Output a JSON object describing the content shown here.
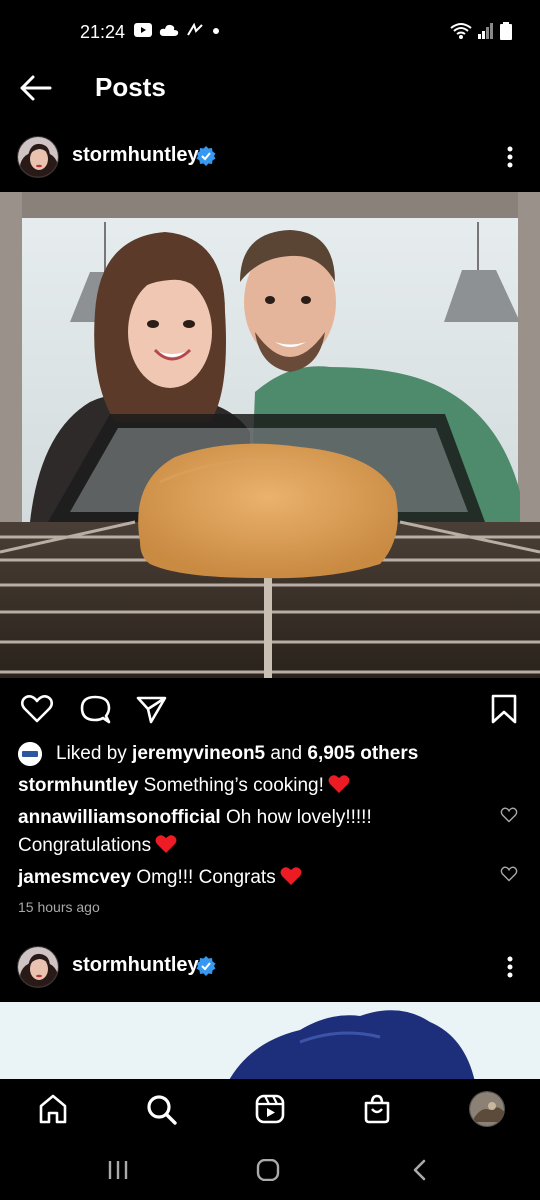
{
  "status_bar": {
    "time": "21:24",
    "left_icons": [
      "youtube-icon",
      "cloud-icon",
      "wave-icon",
      "dot-icon"
    ],
    "right_icons": [
      "wifi-icon",
      "signal-icon",
      "battery-icon"
    ]
  },
  "header": {
    "title": "Posts",
    "back_icon": "back-arrow-icon"
  },
  "post": {
    "username": "stormhuntley",
    "verified": true,
    "image_description_icon": "photo",
    "likes": {
      "prefix": "Liked by ",
      "liked_by": "jeremyvineon5",
      "middle": " and ",
      "others": "6,905 others"
    },
    "caption": {
      "username": "stormhuntley",
      "text": " Something’s cooking!"
    },
    "comments": [
      {
        "username": "annawilliamsonofficial",
        "text": " Oh how lovely!!!!! Congratulations"
      },
      {
        "username": "jamesmcvey",
        "text": " Omg!!! Congrats"
      }
    ],
    "time_ago": "15 hours ago"
  },
  "post2": {
    "username": "stormhuntley",
    "verified": true
  },
  "bottom_nav": {
    "items": [
      "home-icon",
      "search-icon",
      "reels-icon",
      "shop-icon",
      "profile-avatar"
    ]
  },
  "colors": {
    "background": "#000000",
    "verified_blue": "#3897f0",
    "heart_red": "#ed1c24",
    "muted_text": "#a8a8a8"
  }
}
